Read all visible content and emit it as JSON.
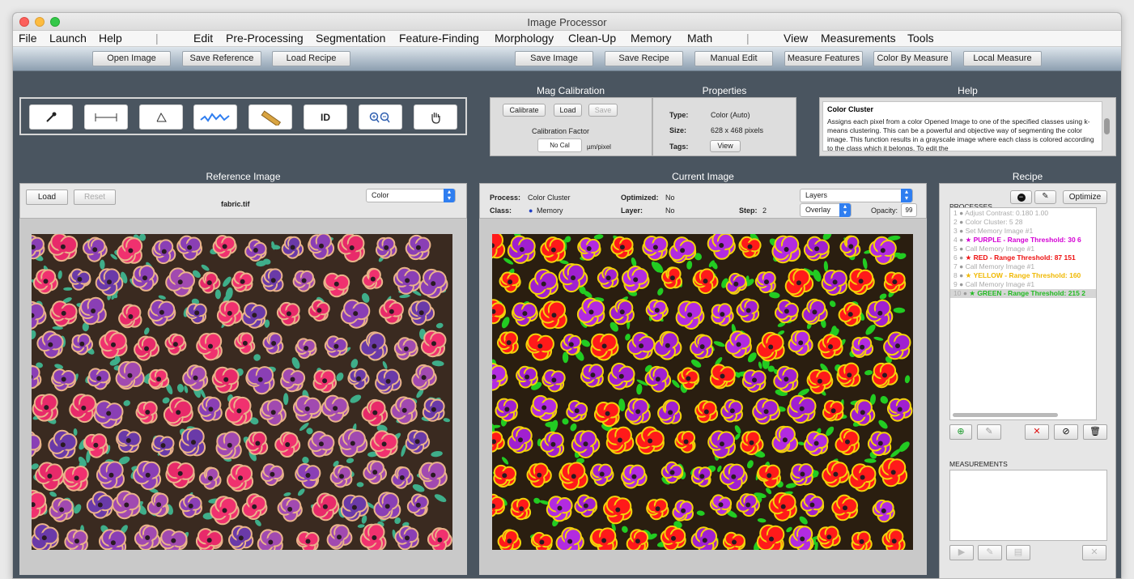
{
  "window": {
    "title": "Image Processor"
  },
  "menu": [
    "File",
    "Launch",
    "Help",
    "|",
    "Edit",
    "Pre-Processing",
    "Segmentation",
    "Feature-Finding",
    "Morphology",
    "Clean-Up",
    "Memory",
    "Math",
    "|",
    "View",
    "Measurements",
    "Tools"
  ],
  "toolbar": {
    "open": "Open Image",
    "save_ref": "Save Reference",
    "load_recipe": "Load Recipe",
    "save_image": "Save Image",
    "save_recipe": "Save Recipe",
    "manual_edit": "Manual Edit",
    "measure_features": "Measure Features",
    "color_by_measure": "Color By Measure",
    "local_measure": "Local Measure"
  },
  "tools": {
    "id_label": "ID"
  },
  "mag": {
    "title": "Mag Calibration",
    "calibrate": "Calibrate",
    "load": "Load",
    "save": "Save",
    "factor_label": "Calibration Factor",
    "factor_value": "No Cal",
    "unit": "µm/pixel"
  },
  "properties": {
    "title": "Properties",
    "type_label": "Type:",
    "type_value": "Color (Auto)",
    "size_label": "Size:",
    "size_value": "628 x 468 pixels",
    "tags_label": "Tags:",
    "view": "View"
  },
  "help": {
    "title": "Help",
    "heading": "Color Cluster",
    "text": "Assigns each pixel from a color Opened Image to one of the specified classes using k-means clustering. This can be a powerful and objective way of segmenting the color image. This function results in a grayscale image where each class is colored according to the class which it belongs. To edit the"
  },
  "reference": {
    "title": "Reference Image",
    "load": "Load",
    "reset": "Reset",
    "filename": "fabric.tif",
    "mode": "Color"
  },
  "current": {
    "title": "Current Image",
    "process_label": "Process:",
    "process_value": "Color Cluster",
    "optimized_label": "Optimized:",
    "optimized_value": "No",
    "class_label": "Class:",
    "class_value": "Memory",
    "layer_label": "Layer:",
    "layer_value": "No",
    "step_label": "Step:",
    "step_value": "2",
    "layers_select": "Layers",
    "overlay_select": "Overlay",
    "opacity_label": "Opacity:",
    "opacity_value": "99"
  },
  "recipe": {
    "title": "Recipe",
    "processes_label": "PROCESSES",
    "optimize": "Optimize",
    "measurements_label": "MEASUREMENTS",
    "items": [
      {
        "n": "1",
        "text": "Adjust Contrast: 0.180 1.00",
        "color": "#aaaaaa",
        "star": false,
        "bold": false
      },
      {
        "n": "2",
        "text": "Color Cluster: 5 28",
        "color": "#aaaaaa",
        "star": false,
        "bold": false
      },
      {
        "n": "3",
        "text": "Set Memory Image #1",
        "color": "#aaaaaa",
        "star": false,
        "bold": false
      },
      {
        "n": "4",
        "text": "PURPLE - Range Threshold: 30 6",
        "color": "#d400d4",
        "star": true,
        "bold": true
      },
      {
        "n": "5",
        "text": "Call Memory Image #1",
        "color": "#aaaaaa",
        "star": false,
        "bold": false
      },
      {
        "n": "6",
        "text": "RED - Range Threshold: 87 151",
        "color": "#ee1111",
        "star": true,
        "bold": true
      },
      {
        "n": "7",
        "text": "Call Memory Image #1",
        "color": "#aaaaaa",
        "star": false,
        "bold": false
      },
      {
        "n": "8",
        "text": "YELLOW - Range Threshold: 160",
        "color": "#f0b800",
        "star": true,
        "bold": true
      },
      {
        "n": "9",
        "text": "Call Memory Image #1",
        "color": "#aaaaaa",
        "star": false,
        "bold": false
      },
      {
        "n": "10",
        "text": "GREEN - Range Threshold: 215 2",
        "color": "#22bb22",
        "star": true,
        "bold": true
      }
    ]
  }
}
